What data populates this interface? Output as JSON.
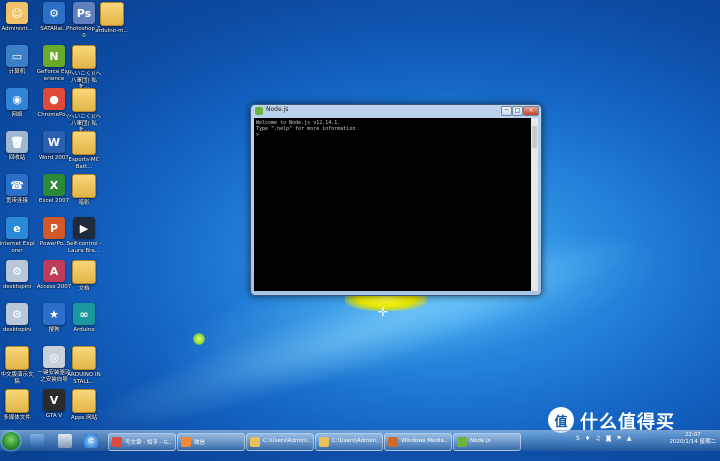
{
  "desktop": {
    "icons": [
      {
        "label": "Administr...",
        "color": "#f0c26a",
        "glyph": "☺"
      },
      {
        "label": "SATARai...",
        "color": "#2b6fc9",
        "glyph": "⚙"
      },
      {
        "label": "Photoshop 7.0",
        "color": "#5f7fc0",
        "glyph": "Ps"
      },
      {
        "label": "arduino-m...",
        "color": "#e8c15a",
        "glyph": ""
      },
      {
        "label": "计算机",
        "color": "#3a7fc8",
        "glyph": "▭"
      },
      {
        "label": "GeForce Experience",
        "color": "#6aaa2a",
        "glyph": "N"
      },
      {
        "label": "(へいこく)(へ八軍団) 私を...",
        "color": "#e8c15a",
        "glyph": ""
      },
      {
        "label": "网络",
        "color": "#2f84d8",
        "glyph": "◉"
      },
      {
        "label": "ChromePo...",
        "color": "#e04a3a",
        "glyph": "●"
      },
      {
        "label": "(へいこく)(へ八軍団) 私を...",
        "color": "#e8c15a",
        "glyph": ""
      },
      {
        "label": "回收站",
        "color": "#9fb8d0",
        "glyph": "🗑"
      },
      {
        "label": "Word 2007",
        "color": "#2b5fb0",
        "glyph": "W"
      },
      {
        "label": "Esports-MC Batt...",
        "color": "#e8c15a",
        "glyph": ""
      },
      {
        "label": "宽带连接",
        "color": "#2b6fc9",
        "glyph": "☎"
      },
      {
        "label": "Excel 2007",
        "color": "#2a8a3a",
        "glyph": "X"
      },
      {
        "label": "暗影",
        "color": "#e8c15a",
        "glyph": ""
      },
      {
        "label": "Internet Explorer",
        "color": "#2b8ad8",
        "glyph": "e"
      },
      {
        "label": "PowerPo...",
        "color": "#d0582a",
        "glyph": "P"
      },
      {
        "label": "Self-control - Laura Bra...",
        "color": "#1f2a3a",
        "glyph": "▶"
      },
      {
        "label": "desktopini",
        "color": "#b8c8d8",
        "glyph": "⚙"
      },
      {
        "label": "Access 2007",
        "color": "#c03a5a",
        "glyph": "A"
      },
      {
        "label": "文档",
        "color": "#e8c15a",
        "glyph": ""
      },
      {
        "label": "desktopini",
        "color": "#b8c8d8",
        "glyph": "⚙"
      },
      {
        "label": "搜狗",
        "color": "#2b6fc9",
        "glyph": "★"
      },
      {
        "label": "Arduino",
        "color": "#1a9aa0",
        "glyph": "∞"
      },
      {
        "label": "中文版演示文稿",
        "color": "#e8c15a",
        "glyph": ""
      },
      {
        "label": "一键安装驱动 之安装向导",
        "color": "#c8d0d8",
        "glyph": "◎"
      },
      {
        "label": "ARDUINO INSTALL...",
        "color": "#f2f2f2",
        "glyph": ""
      },
      {
        "label": "多媒体文件",
        "color": "#e8c15a",
        "glyph": ""
      },
      {
        "label": "GTA V",
        "color": "#2a2a2a",
        "glyph": "V"
      },
      {
        "label": "Apps 网站",
        "color": "#e8c15a",
        "glyph": ""
      }
    ]
  },
  "window": {
    "title": "Node.js",
    "minimize": "─",
    "maximize": "□",
    "close": "×",
    "console_lines": [
      "Welcome to Node.js v12.14.1.",
      "Type \".help\" for more information.",
      ">"
    ]
  },
  "taskbar": {
    "items": [
      {
        "label": "写文章 - 知乎 - G...",
        "color": "#e04a3a"
      },
      {
        "label": "微信",
        "color": "#f08a3a"
      },
      {
        "label": "C:\\Users\\Admini...",
        "color": "#e8c15a"
      },
      {
        "label": "C:\\Users\\Admini...",
        "color": "#e8c15a"
      },
      {
        "label": "Windows Media...",
        "color": "#d06a2a"
      },
      {
        "label": "Node.js",
        "color": "#6cb33f"
      }
    ],
    "clock_time": "22:07",
    "clock_date": "2020/1/14 星期二",
    "tray_icons": [
      "S",
      "♦",
      "♫",
      "◙",
      "⚑",
      "▲"
    ]
  },
  "watermark": {
    "text": "什么值得买",
    "badge": "值"
  }
}
